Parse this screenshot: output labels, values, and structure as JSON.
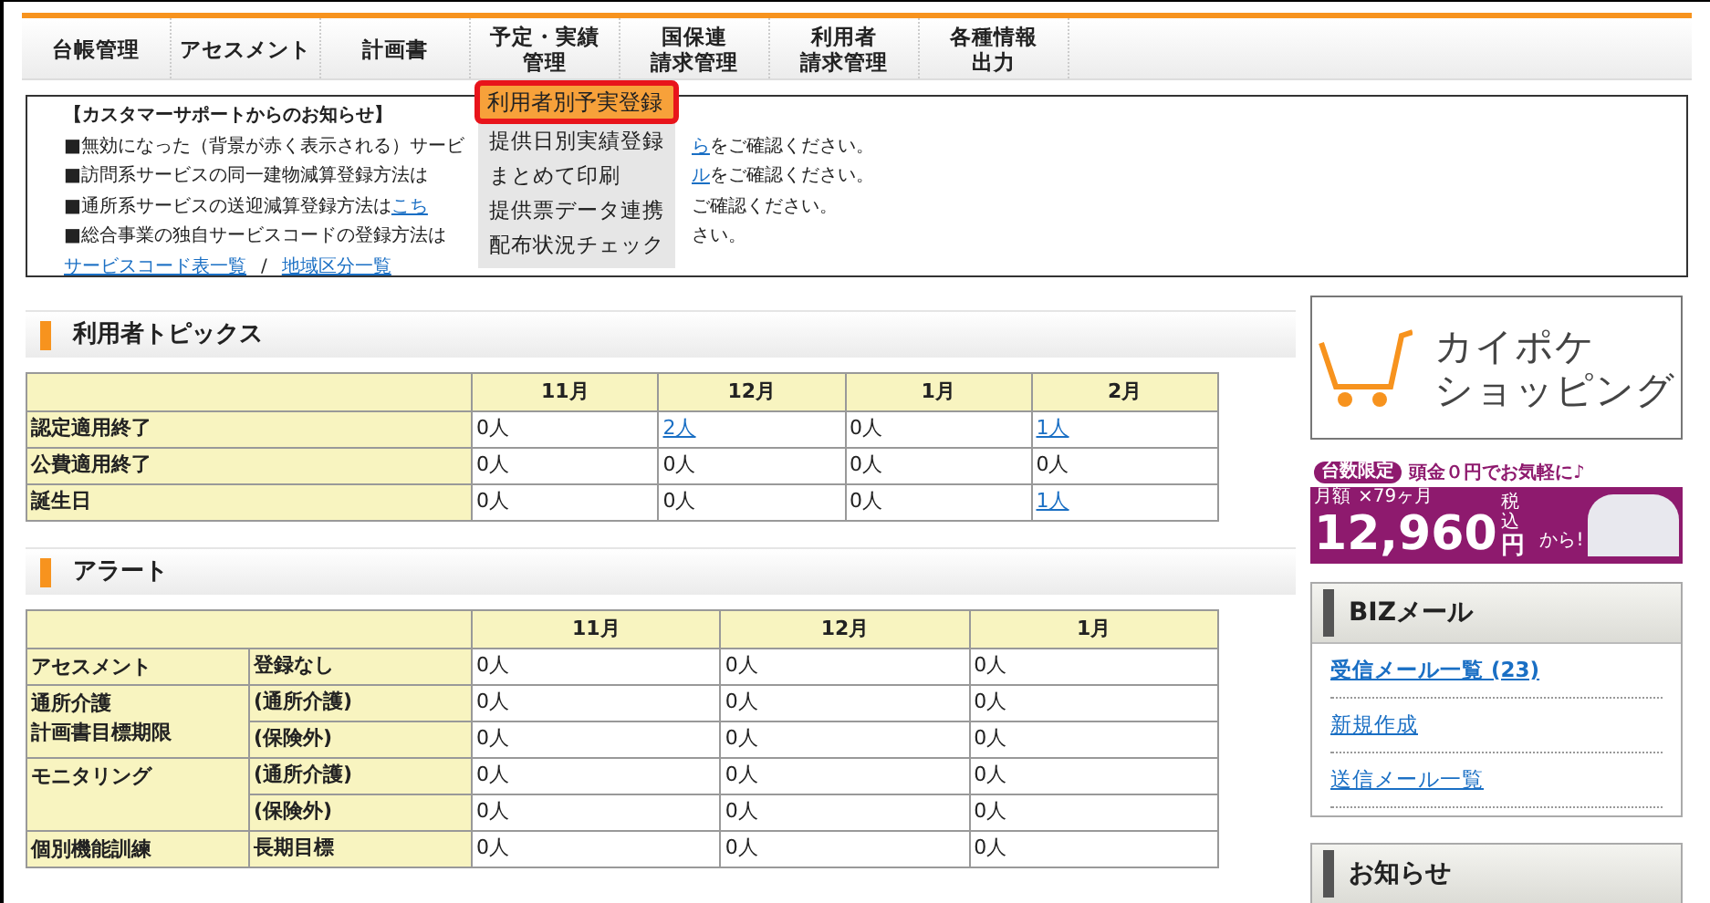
{
  "nav": {
    "tabs": [
      {
        "lines": [
          "台帳管理"
        ]
      },
      {
        "lines": [
          "アセスメント"
        ]
      },
      {
        "lines": [
          "計画書"
        ]
      },
      {
        "lines": [
          "予定・実績",
          "管理"
        ]
      },
      {
        "lines": [
          "国保連",
          "請求管理"
        ]
      },
      {
        "lines": [
          "利用者",
          "請求管理"
        ]
      },
      {
        "lines": [
          "各種情報",
          "出力"
        ]
      }
    ]
  },
  "dropdown": {
    "items": [
      {
        "label": "利用者別予実登録",
        "selected": true
      },
      {
        "label": "提供日別実績登録",
        "selected": false
      },
      {
        "label": "まとめて印刷",
        "selected": false
      },
      {
        "label": "提供票データ連携",
        "selected": false
      },
      {
        "label": "配布状況チェック",
        "selected": false
      }
    ]
  },
  "notice": {
    "title": "【カスタマーサポートからのお知らせ】",
    "lines": [
      {
        "left": [
          {
            "text": "■無効になった（背景が赤く表示される）サービ",
            "link": false
          }
        ],
        "right": [
          {
            "text": "ら",
            "link": true
          },
          {
            "text": "をご確認ください。",
            "link": false
          }
        ]
      },
      {
        "left": [
          {
            "text": "■訪問系サービスの同一建物減算登録方法は",
            "link": false
          }
        ],
        "right": [
          {
            "text": "ル",
            "link": true
          },
          {
            "text": "をご確認ください。",
            "link": false
          }
        ]
      },
      {
        "left": [
          {
            "text": "■通所系サービスの送迎減算登録方法は",
            "link": false
          },
          {
            "text": "こち",
            "link": true
          }
        ],
        "right": [
          {
            "text": "ご確認ください。",
            "link": false
          }
        ]
      },
      {
        "left": [
          {
            "text": "■総合事業の独自サービスコードの登録方法は",
            "link": false
          }
        ],
        "right": [
          {
            "text": "さい。",
            "link": false
          }
        ]
      }
    ],
    "links": [
      "サービスコード表一覧",
      "地域区分一覧"
    ],
    "separator": "/"
  },
  "topics": {
    "title": "利用者トピックス",
    "columns": [
      "11月",
      "12月",
      "1月",
      "2月"
    ],
    "rows": [
      {
        "label": "認定適用終了",
        "cells": [
          {
            "text": "0人",
            "link": false
          },
          {
            "text": "2人",
            "link": true
          },
          {
            "text": "0人",
            "link": false
          },
          {
            "text": "1人",
            "link": true
          }
        ]
      },
      {
        "label": "公費適用終了",
        "cells": [
          {
            "text": "0人",
            "link": false
          },
          {
            "text": "0人",
            "link": false
          },
          {
            "text": "0人",
            "link": false
          },
          {
            "text": "0人",
            "link": false
          }
        ]
      },
      {
        "label": "誕生日",
        "cells": [
          {
            "text": "0人",
            "link": false
          },
          {
            "text": "0人",
            "link": false
          },
          {
            "text": "0人",
            "link": false
          },
          {
            "text": "1人",
            "link": true
          }
        ]
      }
    ]
  },
  "alert": {
    "title": "アラート",
    "columns": [
      "11月",
      "12月",
      "1月"
    ],
    "groups": [
      {
        "label": [
          "アセスメント"
        ],
        "rows": [
          {
            "sub": "登録なし",
            "cells": [
              "0人",
              "0人",
              "0人"
            ]
          }
        ]
      },
      {
        "label": [
          "通所介護",
          "計画書目標期限"
        ],
        "rows": [
          {
            "sub": "(通所介護)",
            "cells": [
              "0人",
              "0人",
              "0人"
            ]
          },
          {
            "sub": "(保険外)",
            "cells": [
              "0人",
              "0人",
              "0人"
            ]
          }
        ]
      },
      {
        "label": [
          "モニタリング"
        ],
        "rows": [
          {
            "sub": "(通所介護)",
            "cells": [
              "0人",
              "0人",
              "0人"
            ]
          },
          {
            "sub": "(保険外)",
            "cells": [
              "0人",
              "0人",
              "0人"
            ]
          }
        ]
      },
      {
        "label": [
          "個別機能訓練"
        ],
        "rows": [
          {
            "sub": "長期目標",
            "cells": [
              "0人",
              "0人",
              "0人"
            ]
          }
        ]
      }
    ]
  },
  "shop_banner": {
    "line_1": "カイポケ",
    "line_2": "ショッピング"
  },
  "car_ad": {
    "badge": "台数限定",
    "headline": "頭金０円でお気軽に♪",
    "monthly": "月額",
    "term": "×79ヶ月",
    "price": "12,960",
    "tax": "税込",
    "yen": "円",
    "from": "から!"
  },
  "biz_mail": {
    "title": "BIZメール",
    "links": [
      "受信メール一覧 (23)",
      "新規作成",
      "送信メール一覧"
    ]
  },
  "news": {
    "title": "お知らせ"
  }
}
